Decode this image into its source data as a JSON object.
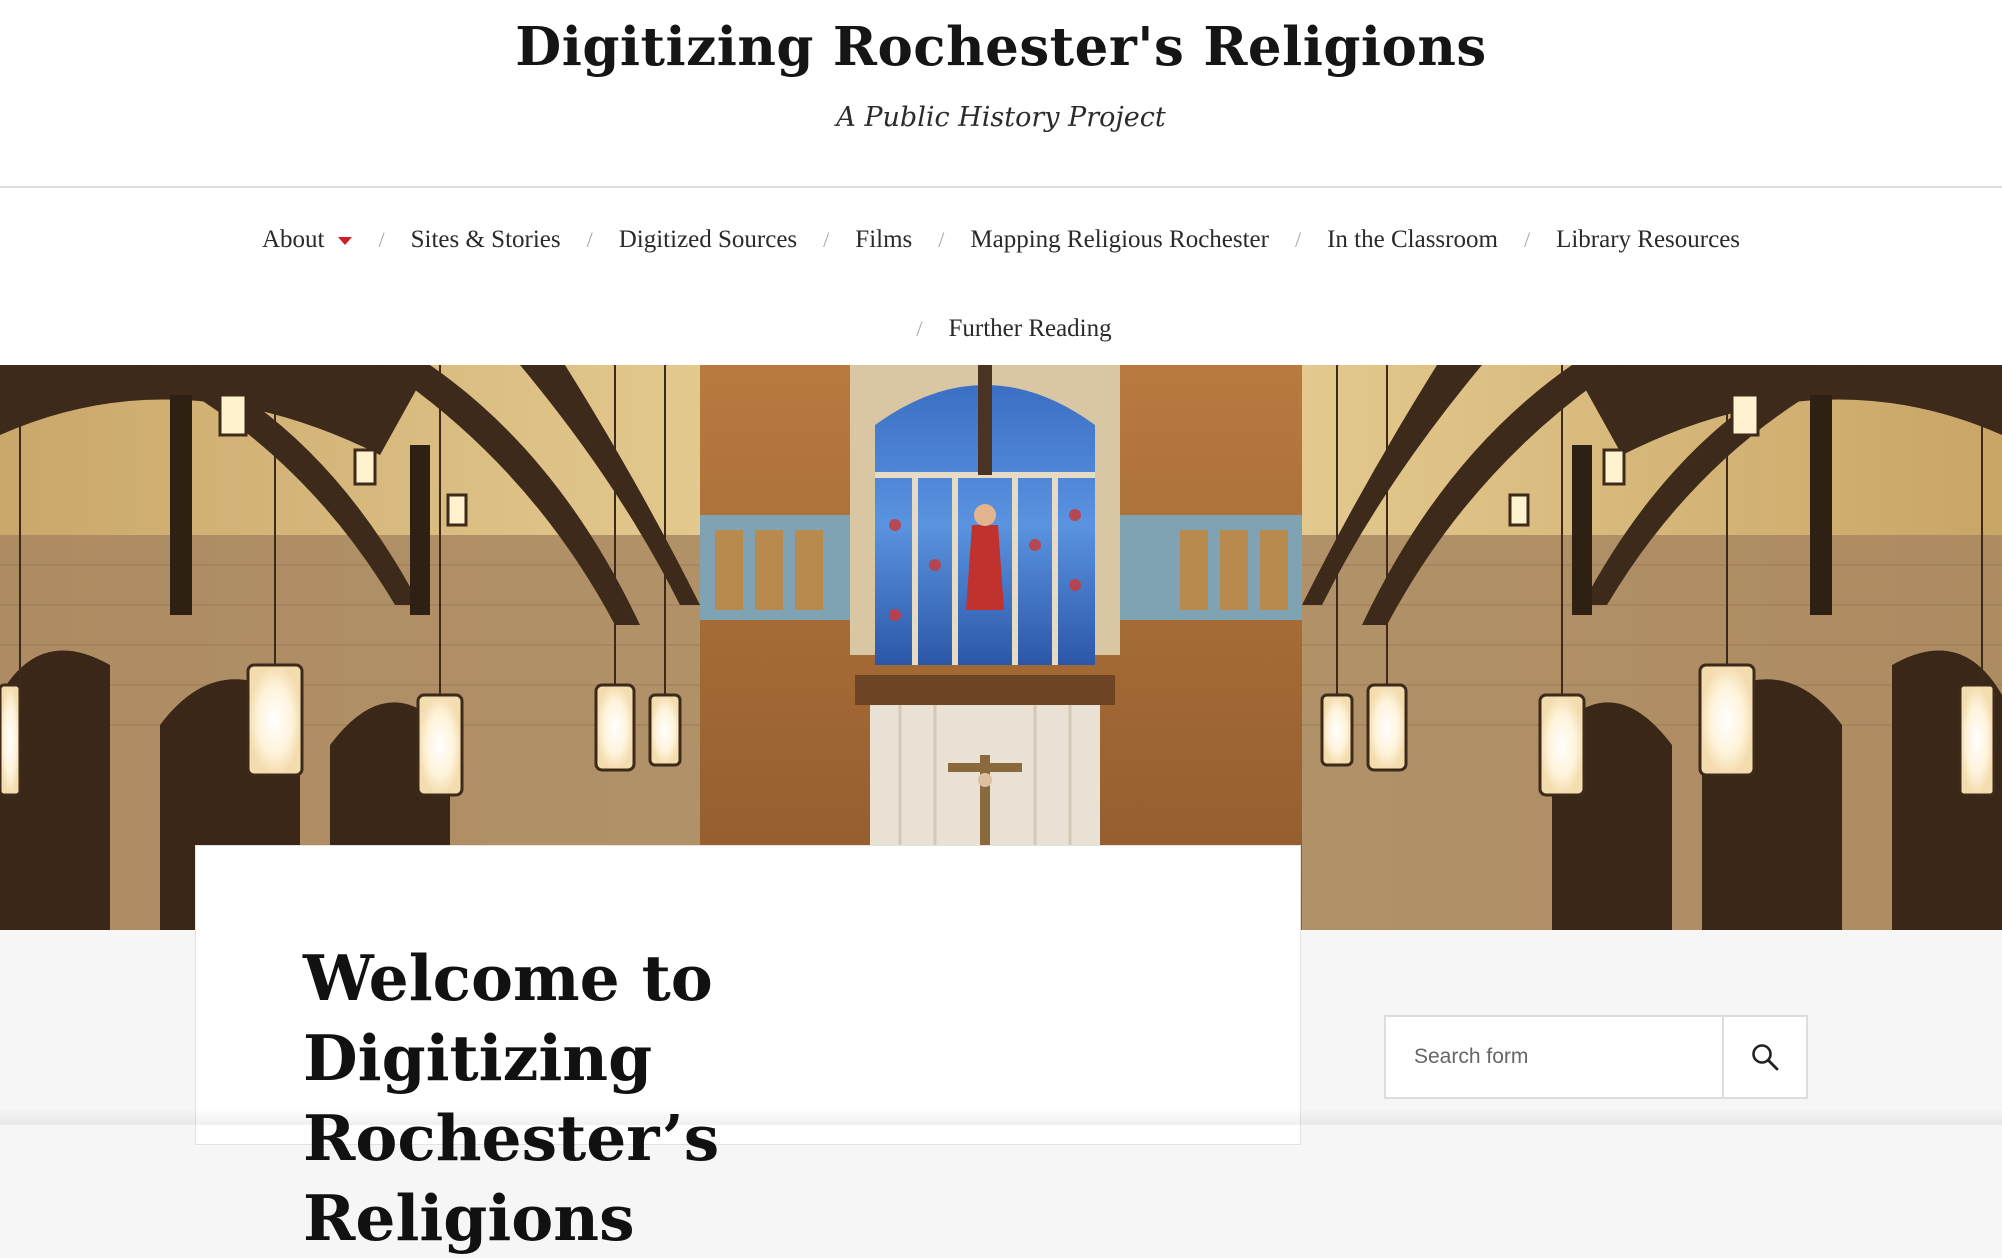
{
  "header": {
    "site_title": "Digitizing Rochester's Religions",
    "tagline": "A Public History Project"
  },
  "nav": {
    "items": [
      {
        "label": "About",
        "has_dropdown": true
      },
      {
        "label": "Sites & Stories"
      },
      {
        "label": "Digitized Sources"
      },
      {
        "label": "Films"
      },
      {
        "label": "Mapping Religious Rochester"
      },
      {
        "label": "In the Classroom"
      },
      {
        "label": "Library Resources"
      },
      {
        "label": "Further Reading"
      }
    ],
    "separator": "/",
    "dropdown_color": "#cc1f2a"
  },
  "hero": {
    "image": "church-interior"
  },
  "post": {
    "title": "Welcome to Digitizing Rochester’s Religions"
  },
  "search": {
    "placeholder": "Search form",
    "value": "",
    "icon": "search-icon"
  }
}
